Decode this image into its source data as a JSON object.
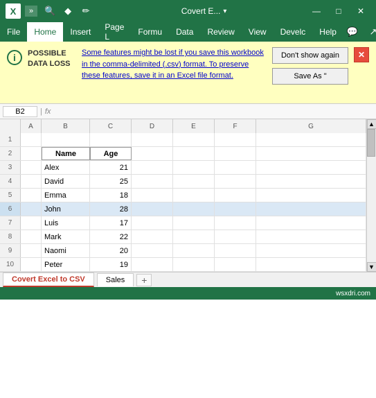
{
  "titlebar": {
    "logo": "X",
    "more_label": "»",
    "title": "Covert E...",
    "title_chevron": "▾",
    "search_icon": "🔍",
    "diamond_icon": "◆",
    "pen_icon": "✏",
    "minimize": "—",
    "maximize": "□",
    "close": "✕"
  },
  "ribbon": {
    "tabs": [
      "File",
      "Home",
      "Insert",
      "Page L",
      "Formu",
      "Data",
      "Review",
      "View",
      "Develc",
      "Help"
    ],
    "active_tab": "Home",
    "right_icons": [
      "💬",
      "↗"
    ]
  },
  "warning": {
    "icon": "i",
    "label": "POSSIBLE DATA LOSS",
    "text": "Some features might be lost if you save this workbook in the comma-delimited (.csv) format. To preserve these features, save it in an Excel file format.",
    "dont_show_btn": "Don't show again",
    "save_as_btn": "Save As \"",
    "close_icon": "✕"
  },
  "formula_bar": {
    "name_box": "B2"
  },
  "columns": [
    "A",
    "B",
    "C",
    "D",
    "E",
    "F",
    "G"
  ],
  "rows": [
    1,
    2,
    3,
    4,
    5,
    6,
    7,
    8,
    9,
    10
  ],
  "table": {
    "headers": [
      "Name",
      "Age"
    ],
    "rows": [
      {
        "name": "Alex",
        "age": "21"
      },
      {
        "name": "David",
        "age": "25"
      },
      {
        "name": "Emma",
        "age": "18"
      },
      {
        "name": "John",
        "age": "28"
      },
      {
        "name": "Luis",
        "age": "17"
      },
      {
        "name": "Mark",
        "age": "22"
      },
      {
        "name": "Naomi",
        "age": "20"
      },
      {
        "name": "Peter",
        "age": "19"
      }
    ]
  },
  "tabs": {
    "active": "Covert Excel to CSV",
    "inactive": [
      "Sales"
    ],
    "add_icon": "+"
  },
  "bottombar": {
    "watermark": "wsxdri.com"
  }
}
